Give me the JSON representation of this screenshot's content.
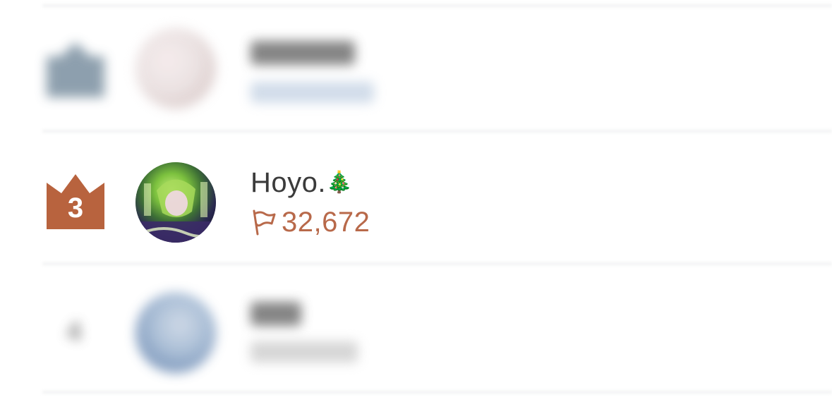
{
  "leaderboard": {
    "rows": [
      {
        "rank": "2",
        "name": "",
        "score": "",
        "blurred": true
      },
      {
        "rank": "3",
        "name": "Hoyo.",
        "name_suffix": "🎄",
        "score": "32,672",
        "blurred": false
      },
      {
        "rank": "4",
        "name": "",
        "score": "",
        "blurred": true
      }
    ]
  },
  "colors": {
    "rank3_badge": "#b8633e",
    "rank2_badge": "#7a8fa0",
    "score_accent": "#b8694a",
    "name_text": "#3b3b3b",
    "divider": "#f1f2f3"
  },
  "icons": {
    "crown": "crown-icon",
    "flag": "flag-icon"
  }
}
